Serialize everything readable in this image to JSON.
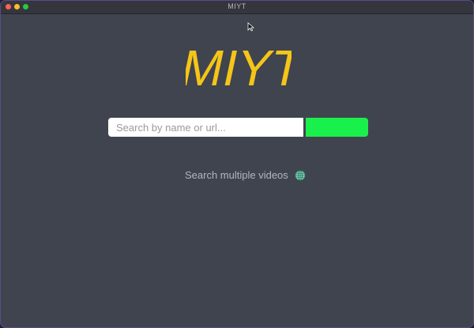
{
  "window": {
    "title": "MIYT"
  },
  "logo": {
    "text": "MIYT",
    "color": "#f5c518"
  },
  "search": {
    "placeholder": "Search by name or url...",
    "value": "",
    "button_label": "",
    "button_color": "#19f04c"
  },
  "multi_search": {
    "label": "Search multiple videos",
    "icon": "globe-icon"
  },
  "colors": {
    "background": "#40444f",
    "titlebar": "#35363d",
    "text_muted": "#b4b6bc"
  }
}
